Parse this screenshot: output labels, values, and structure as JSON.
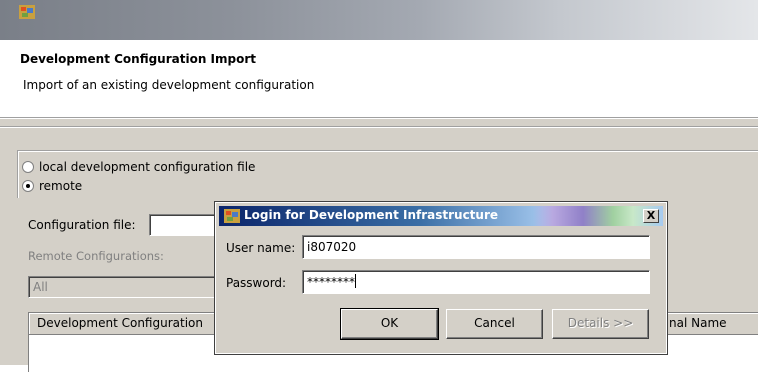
{
  "window": {
    "icon": "app-icon"
  },
  "header": {
    "title": "Development Configuration Import",
    "description": "Import of an existing development configuration"
  },
  "source": {
    "options": [
      {
        "label": "local development configuration file",
        "selected": false
      },
      {
        "label": "remote",
        "selected": true
      }
    ]
  },
  "form": {
    "config_file_label": "Configuration file:",
    "config_file_value": "",
    "remote_configs_label": "Remote Configurations:",
    "remote_configs_value": "All"
  },
  "table": {
    "columns": [
      "Development Configuration",
      "nal Name"
    ]
  },
  "dialog": {
    "title": "Login for Development Infrastructure",
    "close_label": "X",
    "username_label": "User name:",
    "username_value": "i807020",
    "password_label": "Password:",
    "password_value": "********",
    "ok_label": "OK",
    "cancel_label": "Cancel",
    "details_label": "Details >>"
  },
  "colors": {
    "dialog_title_start": "#0a246a",
    "dialog_title_end": "#a6caf0",
    "panel_bg": "#d4d0c8"
  }
}
